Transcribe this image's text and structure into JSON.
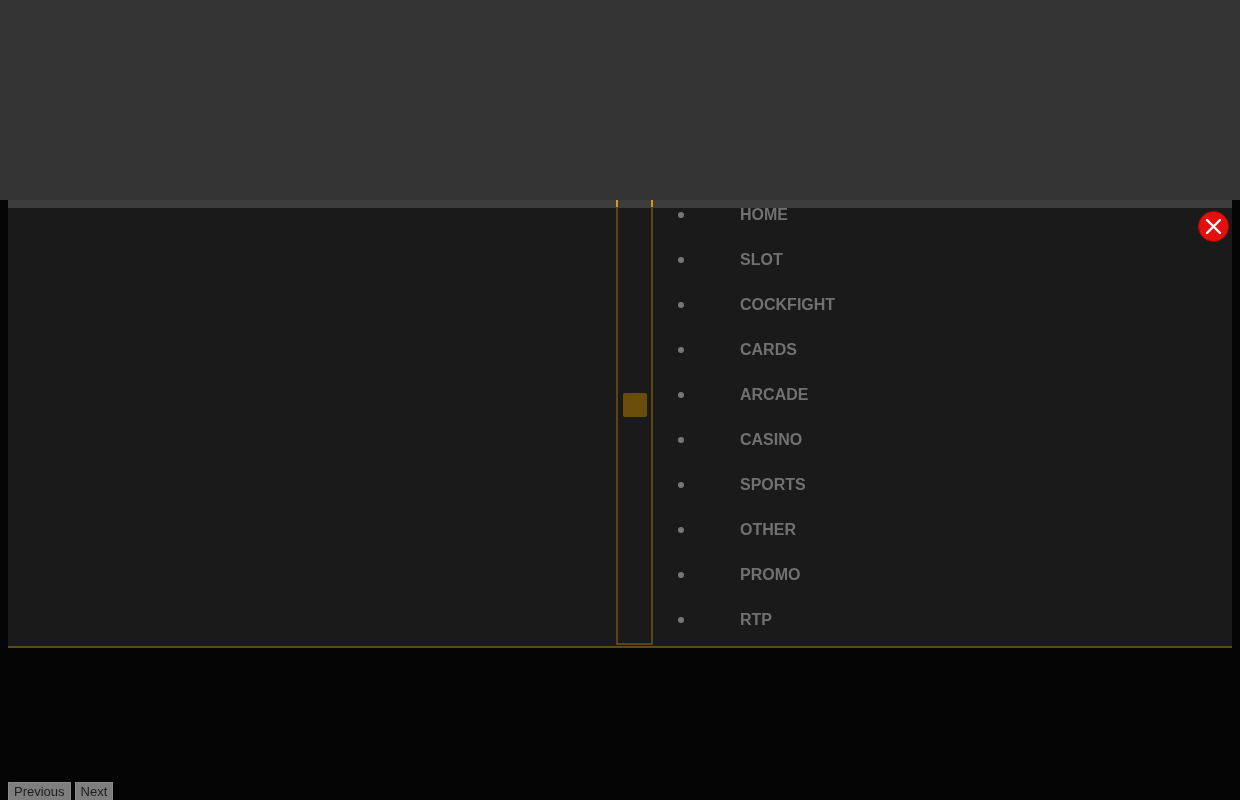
{
  "slider": {
    "level": 0.54
  },
  "nav_menu": {
    "items": [
      {
        "label": "HOME"
      },
      {
        "label": "SLOT"
      },
      {
        "label": "COCKFIGHT"
      },
      {
        "label": "CARDS"
      },
      {
        "label": "ARCADE"
      },
      {
        "label": "CASINO"
      },
      {
        "label": "SPORTS"
      },
      {
        "label": "OTHER"
      },
      {
        "label": "PROMO"
      },
      {
        "label": "RTP"
      }
    ]
  },
  "pagination": {
    "buttons": [
      "Previous",
      "Next"
    ]
  }
}
